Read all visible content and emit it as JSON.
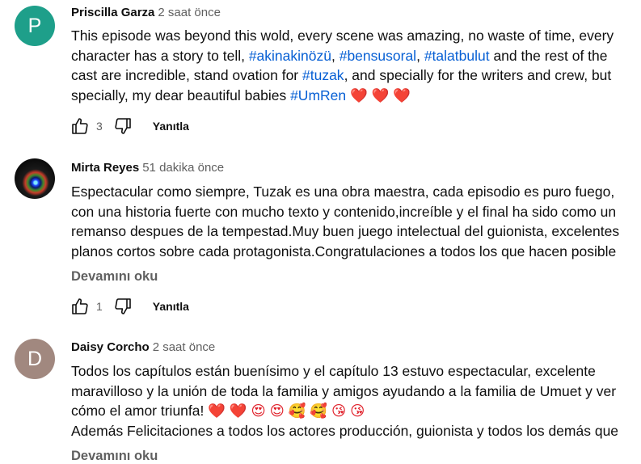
{
  "comments": [
    {
      "avatar_letter": "P",
      "avatar_color": "#1e9f8a",
      "author": "Priscilla Garza",
      "time": "2 saat önce",
      "lines": [
        [
          {
            "t": "This episode was beyond this wold, every scene was amazing, no waste of time, every"
          }
        ],
        [
          {
            "t": "character has a story to tell, "
          },
          {
            "t": "#akinakinözü",
            "tag": true
          },
          {
            "t": ", "
          },
          {
            "t": "#bensusoral",
            "tag": true
          },
          {
            "t": ", "
          },
          {
            "t": "#talatbulut",
            "tag": true
          },
          {
            "t": " and the rest of the"
          }
        ],
        [
          {
            "t": "cast are incredible, stand ovation for "
          },
          {
            "t": "#tuzak",
            "tag": true
          },
          {
            "t": ", and specially for the writers and crew, but"
          }
        ],
        [
          {
            "t": "specially, my dear beautiful babies "
          },
          {
            "t": "#UmRen",
            "tag": true
          },
          {
            "t": " ❤️ ❤️ ❤️",
            "heart": true
          }
        ]
      ],
      "likes": "3",
      "reply_label": "Yanıtla"
    },
    {
      "avatar_letter": "",
      "author": "Mirta Reyes",
      "time": "51 dakika önce",
      "lines": [
        [
          {
            "t": "Espectacular como siempre, Tuzak es una obra maestra, cada episodio es puro fuego,"
          }
        ],
        [
          {
            "t": "con una historia fuerte con mucho texto y contenido,increíble y el final  ha sido como un"
          }
        ],
        [
          {
            "t": "remanso despues de la tempestad.Muy buen juego intelectual del guionista, excelentes"
          }
        ],
        [
          {
            "t": "planos cortos sobre cada protagonista.Congratulaciones a todos los que hacen posible"
          }
        ]
      ],
      "read_more": "Devamını oku",
      "likes": "1",
      "reply_label": "Yanıtla"
    },
    {
      "avatar_letter": "D",
      "avatar_color": "#a1887f",
      "author": "Daisy Corcho",
      "time": "2 saat önce",
      "lines": [
        [
          {
            "t": "Todos los capítulos están buenísimo y el capítulo 13 estuvo espectacular, excelente"
          }
        ],
        [
          {
            "t": "maravilloso y la unión de toda la familia y amigos ayudando a la familia de Umuet y ver"
          }
        ],
        [
          {
            "t": "cómo el amor triunfa! "
          },
          {
            "t": "❤️ ❤️ 😍 😍 🥰 🥰 😘 😘",
            "heart": true
          }
        ],
        [
          {
            "t": "Además Felicitaciones a todos los actores producción, guionista y todos los demás que"
          }
        ]
      ],
      "read_more": "Devamını oku"
    }
  ]
}
